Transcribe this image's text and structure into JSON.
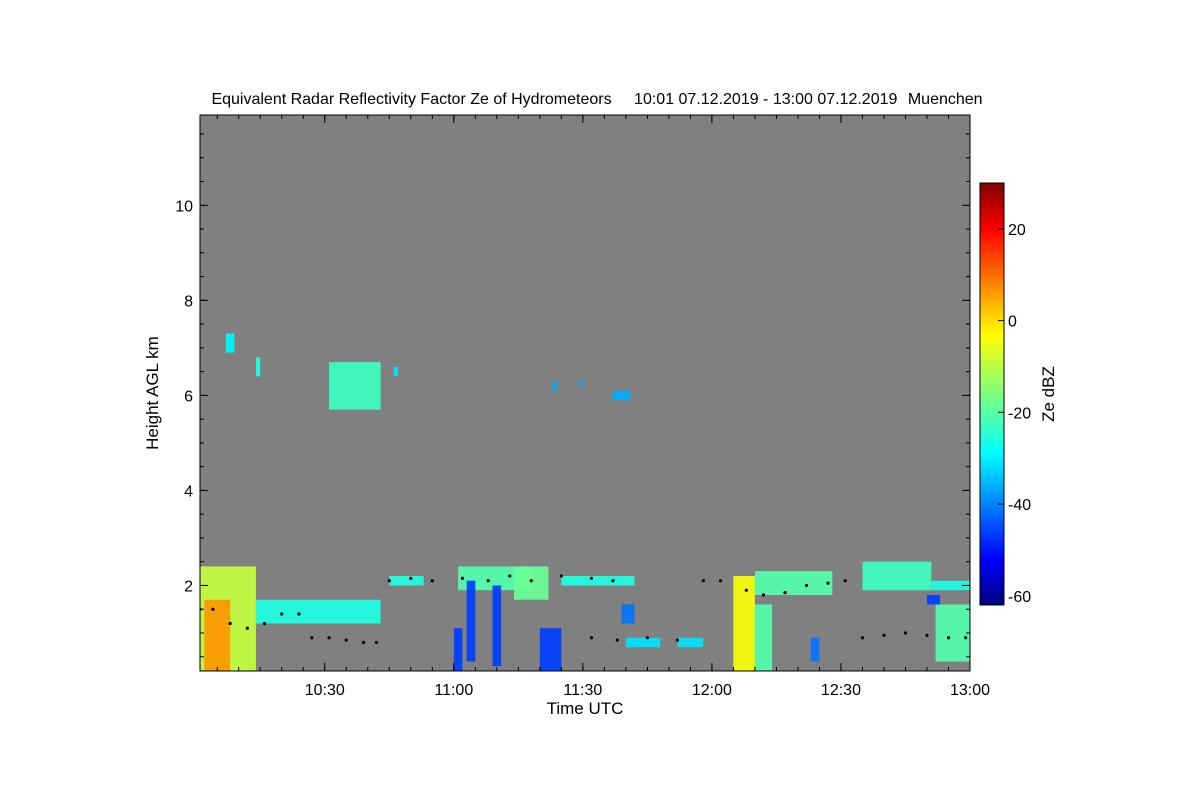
{
  "chart_data": {
    "type": "heatmap",
    "title": "Equivalent Radar Reflectivity Factor Ze of Hydrometeors",
    "period": "10:01 07.12.2019 - 13:00 07.12.2019",
    "location": "Muenchen",
    "xlabel": "Time UTC",
    "ylabel": "Height AGL km",
    "xlim": [
      "10:01",
      "13:00"
    ],
    "xticks": [
      "10:30",
      "11:00",
      "11:30",
      "12:00",
      "12:30",
      "13:00"
    ],
    "ylim": [
      0.2,
      11.9
    ],
    "yticks": [
      2,
      4,
      6,
      8,
      10
    ],
    "colorbar": {
      "label": "Ze dBZ",
      "range": [
        -62,
        30
      ],
      "ticks": [
        -60,
        -40,
        -20,
        0,
        20
      ],
      "colormap": "jet"
    },
    "background_color": "#808080",
    "echoes": [
      {
        "t0": "10:01",
        "t1": "10:14",
        "h0": 0.2,
        "h1": 2.4,
        "ze": -10
      },
      {
        "t0": "10:02",
        "t1": "10:08",
        "h0": 0.2,
        "h1": 1.7,
        "ze": 5
      },
      {
        "t0": "10:14",
        "t1": "10:43",
        "h0": 1.2,
        "h1": 1.7,
        "ze": -25
      },
      {
        "t0": "10:07",
        "t1": "10:09",
        "h0": 6.9,
        "h1": 7.3,
        "ze": -28
      },
      {
        "t0": "10:14",
        "t1": "10:15",
        "h0": 6.4,
        "h1": 6.8,
        "ze": -25
      },
      {
        "t0": "10:31",
        "t1": "10:43",
        "h0": 5.7,
        "h1": 6.7,
        "ze": -22
      },
      {
        "t0": "10:46",
        "t1": "10:47",
        "h0": 6.4,
        "h1": 6.6,
        "ze": -30
      },
      {
        "t0": "11:23",
        "t1": "11:24",
        "h0": 6.1,
        "h1": 6.3,
        "ze": -35
      },
      {
        "t0": "11:29",
        "t1": "11:30",
        "h0": 6.2,
        "h1": 6.3,
        "ze": -35
      },
      {
        "t0": "11:37",
        "t1": "11:41",
        "h0": 5.9,
        "h1": 6.1,
        "ze": -35
      },
      {
        "t0": "10:45",
        "t1": "10:53",
        "h0": 2.0,
        "h1": 2.2,
        "ze": -25
      },
      {
        "t0": "11:01",
        "t1": "11:18",
        "h0": 1.9,
        "h1": 2.4,
        "ze": -20
      },
      {
        "t0": "11:14",
        "t1": "11:22",
        "h0": 1.7,
        "h1": 2.4,
        "ze": -18
      },
      {
        "t0": "11:25",
        "t1": "11:42",
        "h0": 2.0,
        "h1": 2.2,
        "ze": -25
      },
      {
        "t0": "12:05",
        "t1": "12:10",
        "h0": 0.2,
        "h1": 2.2,
        "ze": -5
      },
      {
        "t0": "12:10",
        "t1": "12:14",
        "h0": 0.2,
        "h1": 1.6,
        "ze": -20
      },
      {
        "t0": "12:10",
        "t1": "12:28",
        "h0": 1.8,
        "h1": 2.3,
        "ze": -20
      },
      {
        "t0": "12:35",
        "t1": "12:51",
        "h0": 1.9,
        "h1": 2.5,
        "ze": -22
      },
      {
        "t0": "12:51",
        "t1": "13:00",
        "h0": 1.9,
        "h1": 2.1,
        "ze": -25
      },
      {
        "t0": "12:52",
        "t1": "13:00",
        "h0": 0.4,
        "h1": 1.6,
        "ze": -20
      },
      {
        "t0": "11:00",
        "t1": "11:02",
        "h0": 0.2,
        "h1": 1.1,
        "ze": -45
      },
      {
        "t0": "11:03",
        "t1": "11:05",
        "h0": 0.4,
        "h1": 2.1,
        "ze": -45
      },
      {
        "t0": "11:09",
        "t1": "11:11",
        "h0": 0.3,
        "h1": 2.0,
        "ze": -45
      },
      {
        "t0": "11:20",
        "t1": "11:25",
        "h0": 0.2,
        "h1": 1.1,
        "ze": -45
      },
      {
        "t0": "11:39",
        "t1": "11:42",
        "h0": 1.2,
        "h1": 1.6,
        "ze": -40
      },
      {
        "t0": "11:40",
        "t1": "11:48",
        "h0": 0.7,
        "h1": 0.9,
        "ze": -30
      },
      {
        "t0": "11:52",
        "t1": "11:58",
        "h0": 0.7,
        "h1": 0.9,
        "ze": -30
      },
      {
        "t0": "12:23",
        "t1": "12:25",
        "h0": 0.4,
        "h1": 0.9,
        "ze": -40
      },
      {
        "t0": "12:50",
        "t1": "12:53",
        "h0": 1.6,
        "h1": 1.8,
        "ze": -45
      }
    ],
    "cloud_base_points": [
      {
        "t": "10:01",
        "h": 1.5
      },
      {
        "t": "10:04",
        "h": 1.5
      },
      {
        "t": "10:08",
        "h": 1.2
      },
      {
        "t": "10:12",
        "h": 1.1
      },
      {
        "t": "10:16",
        "h": 1.2
      },
      {
        "t": "10:20",
        "h": 1.4
      },
      {
        "t": "10:24",
        "h": 1.4
      },
      {
        "t": "10:27",
        "h": 0.9
      },
      {
        "t": "10:31",
        "h": 0.9
      },
      {
        "t": "10:35",
        "h": 0.85
      },
      {
        "t": "10:39",
        "h": 0.8
      },
      {
        "t": "10:42",
        "h": 0.8
      },
      {
        "t": "10:45",
        "h": 2.1
      },
      {
        "t": "10:50",
        "h": 2.15
      },
      {
        "t": "10:55",
        "h": 2.1
      },
      {
        "t": "11:02",
        "h": 2.15
      },
      {
        "t": "11:08",
        "h": 2.1
      },
      {
        "t": "11:13",
        "h": 2.2
      },
      {
        "t": "11:18",
        "h": 2.1
      },
      {
        "t": "11:25",
        "h": 2.2
      },
      {
        "t": "11:32",
        "h": 2.15
      },
      {
        "t": "11:37",
        "h": 2.1
      },
      {
        "t": "11:32",
        "h": 0.9
      },
      {
        "t": "11:38",
        "h": 0.85
      },
      {
        "t": "11:45",
        "h": 0.9
      },
      {
        "t": "11:52",
        "h": 0.85
      },
      {
        "t": "11:58",
        "h": 2.1
      },
      {
        "t": "12:02",
        "h": 2.1
      },
      {
        "t": "12:08",
        "h": 1.9
      },
      {
        "t": "12:12",
        "h": 1.8
      },
      {
        "t": "12:17",
        "h": 1.85
      },
      {
        "t": "12:22",
        "h": 2.0
      },
      {
        "t": "12:27",
        "h": 2.05
      },
      {
        "t": "12:31",
        "h": 2.1
      },
      {
        "t": "12:35",
        "h": 0.9
      },
      {
        "t": "12:40",
        "h": 0.95
      },
      {
        "t": "12:45",
        "h": 1.0
      },
      {
        "t": "12:50",
        "h": 0.95
      },
      {
        "t": "12:55",
        "h": 0.9
      },
      {
        "t": "12:59",
        "h": 0.9
      }
    ]
  }
}
